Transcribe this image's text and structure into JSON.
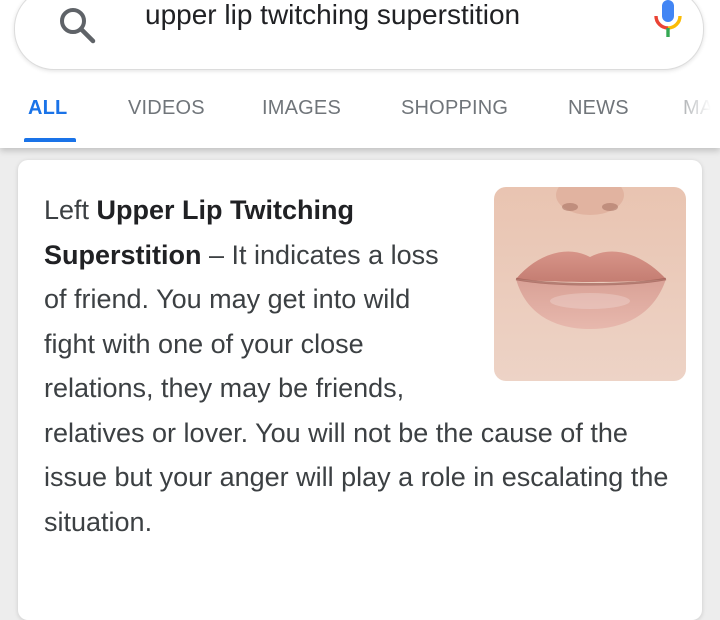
{
  "search": {
    "query": "upper lip twitching superstition"
  },
  "tabs": [
    {
      "label": "ALL",
      "active": true
    },
    {
      "label": "VIDEOS",
      "active": false
    },
    {
      "label": "IMAGES",
      "active": false
    },
    {
      "label": "SHOPPING",
      "active": false
    },
    {
      "label": "NEWS",
      "active": false
    },
    {
      "label": "MA",
      "active": false
    }
  ],
  "result": {
    "lead": "Left ",
    "title": "Upper Lip Twitching Superstition",
    "body": " – It indicates a loss of friend. You may get into wild fight with one of your close relations, they may be friends, relatives or lover. You will not be the cause of the issue but your anger will play a role in escalating the situation.",
    "image_subject": "close-up photo of lips"
  },
  "colors": {
    "accent": "#1a73e8",
    "tab_text": "#70757a",
    "mic_blue": "#4285f4",
    "mic_red": "#ea4335",
    "mic_yellow": "#fbbc05",
    "mic_green": "#34a853"
  }
}
